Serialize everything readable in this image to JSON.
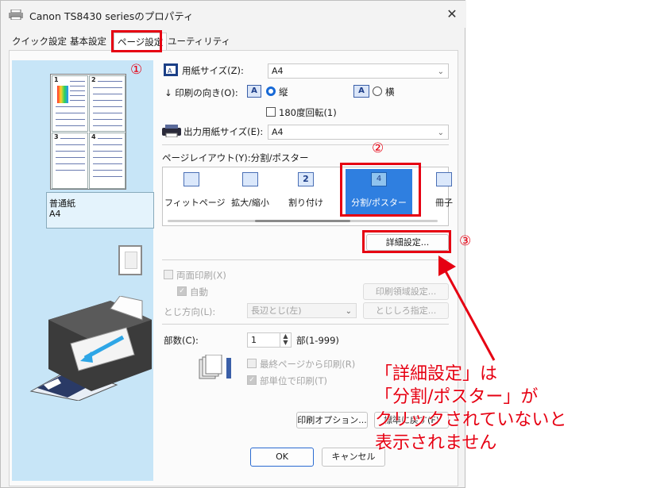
{
  "window": {
    "title": "Canon TS8430 seriesのプロパティ",
    "close": "✕"
  },
  "tabs": [
    {
      "label": "クイック設定"
    },
    {
      "label": "基本設定"
    },
    {
      "label": "ページ設定"
    },
    {
      "label": "ユーティリティ"
    }
  ],
  "preview": {
    "page_numbers": [
      "1",
      "2",
      "3",
      "4"
    ],
    "paper_type": "普通紙",
    "paper_size": "A4"
  },
  "form": {
    "paper_size_label": "用紙サイズ(Z):",
    "paper_size_value": "A4",
    "orientation_label": "印刷の向き(O):",
    "portrait_label": "縦",
    "landscape_label": "横",
    "rotate180_label": "180度回転(1)",
    "output_size_label": "出力用紙サイズ(E):",
    "output_size_value": "A4",
    "layout_label": "ページレイアウト(Y):分割/ポスター",
    "layouts": [
      {
        "label": "フィットページ",
        "icon": "fit-page-icon"
      },
      {
        "label": "拡大/縮小",
        "icon": "scale-icon"
      },
      {
        "label": "割り付け",
        "icon": "n-up-icon",
        "glyph": "2"
      },
      {
        "label": "分割/ポスター",
        "icon": "poster-icon",
        "glyph": "4",
        "selected": true
      },
      {
        "label": "冊子",
        "icon": "booklet-icon"
      }
    ],
    "detail_button": "詳細設定...",
    "duplex_label": "両面印刷(X)",
    "auto_label": "自動",
    "print_area_button": "印刷領域設定...",
    "binding_label": "とじ方向(L):",
    "binding_value": "長辺とじ(左)",
    "margin_button": "とじしろ指定...",
    "copies_label": "部数(C):",
    "copies_value": "1",
    "copies_range": "部(1-999)",
    "reverse_label": "最終ページから印刷(R)",
    "collate_label": "部単位で印刷(T)",
    "print_options_button": "印刷オプション...",
    "defaults_button": "標準に戻す(F)",
    "ok_button": "OK",
    "cancel_button": "キャンセル"
  },
  "annotations": {
    "markers": [
      "①",
      "②",
      "③"
    ],
    "note_lines": [
      "「詳細設定」は",
      "「分割/ポスター」が",
      "クリックされていないと",
      "表示されません"
    ],
    "color": "#e60012"
  }
}
